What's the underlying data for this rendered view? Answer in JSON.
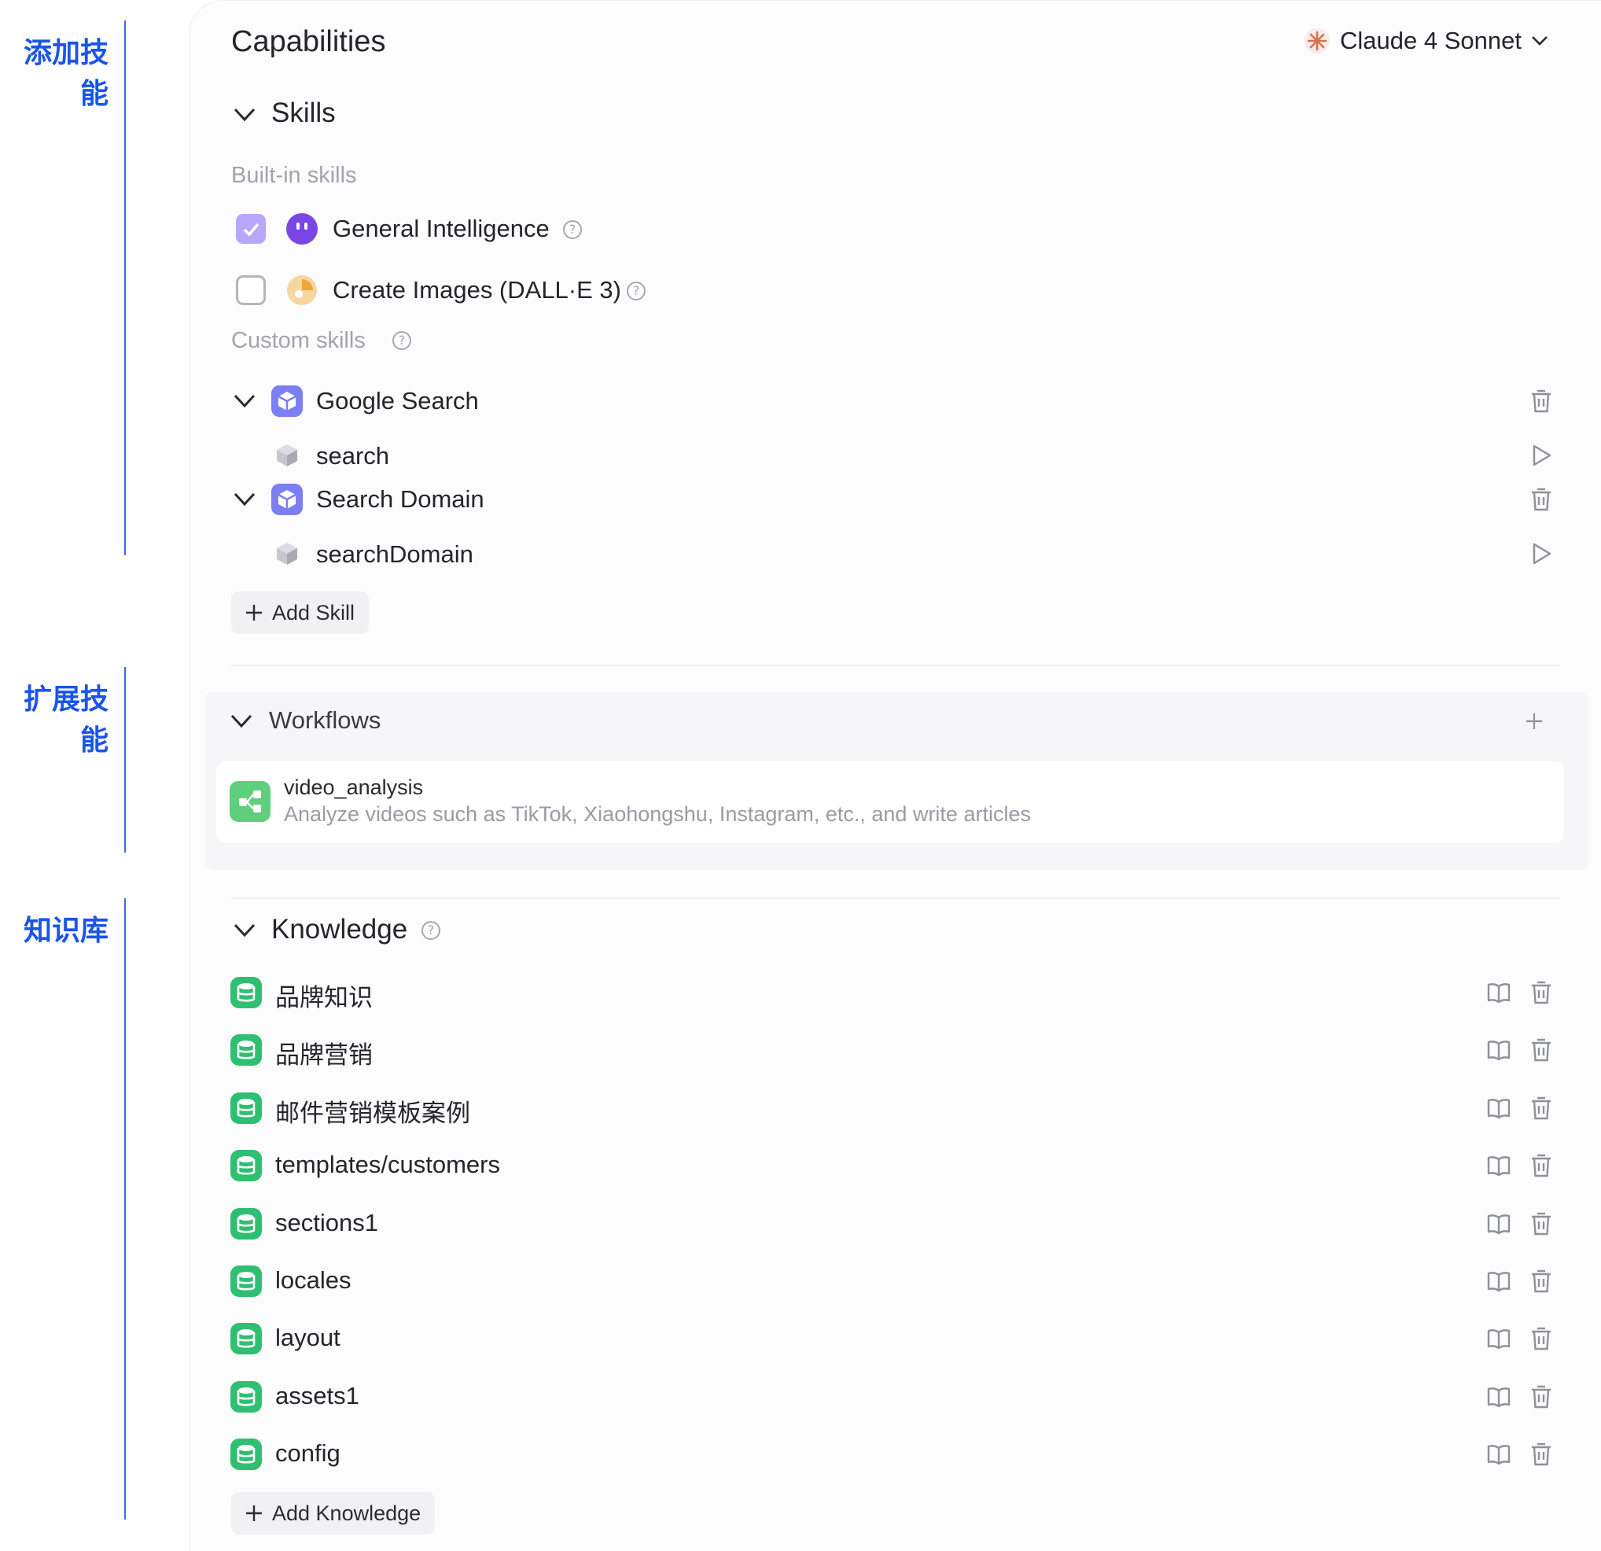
{
  "annotations": [
    "添加技能",
    "扩展技能",
    "知识库"
  ],
  "header": {
    "title": "Capabilities",
    "model": "Claude 4 Sonnet"
  },
  "skills": {
    "title": "Skills",
    "builtin_label": "Built-in skills",
    "builtin": [
      {
        "label": "General Intelligence",
        "checked": true
      },
      {
        "label": "Create Images (DALL·E 3)",
        "checked": false
      }
    ],
    "custom_label": "Custom skills",
    "custom": [
      {
        "label": "Google Search",
        "tool": "search"
      },
      {
        "label": "Search Domain",
        "tool": "searchDomain"
      }
    ],
    "add_label": "Add Skill"
  },
  "workflows": {
    "title": "Workflows",
    "items": [
      {
        "name": "video_analysis",
        "description": "Analyze videos such as TikTok, Xiaohongshu, Instagram, etc., and write articles"
      }
    ]
  },
  "knowledge": {
    "title": "Knowledge",
    "items": [
      "品牌知识",
      "品牌营销",
      "邮件营销模板案例",
      "templates/customers",
      "sections1",
      "locales",
      "layout",
      "assets1",
      "config"
    ],
    "add_label": "Add Knowledge"
  },
  "colors": {
    "annotation": "#1a55e6",
    "checkbox_checked": "#b8a6ff",
    "plugin_icon": "#7b7ff2",
    "knowledge_icon": "#2ebf72",
    "workflow_icon": "#5fcf7d",
    "muted_text": "#a2a3ad"
  }
}
